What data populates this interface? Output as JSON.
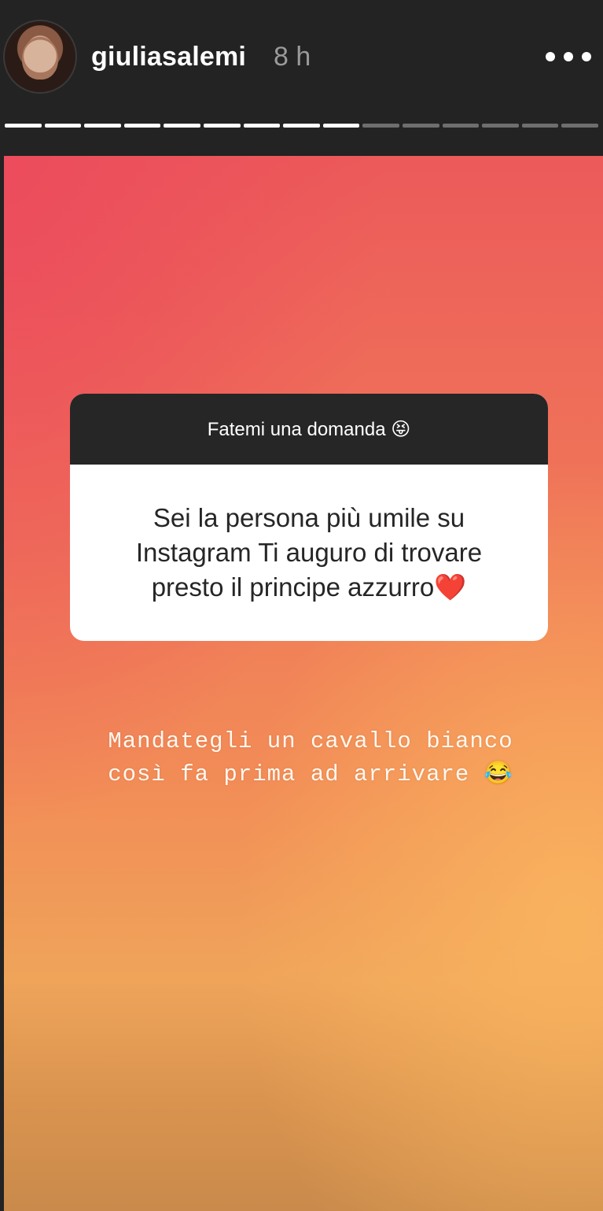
{
  "header": {
    "username": "giuliasalemi",
    "time": "8 h",
    "more_icon": "more-horizontal-icon",
    "progress_total_segments": 15,
    "progress_completed_segments": 9
  },
  "question_sticker": {
    "prompt": "Fatemi una domanda 😝",
    "question": "Sei la persona più umile su Instagram Ti auguro di trovare presto il principe azzurro❤️"
  },
  "reply": {
    "line1": "Mandategli un cavallo bianco",
    "line2": "così fa prima ad arrivare 😂"
  },
  "colors": {
    "header_bg": "#232323",
    "gradient_top": "#ec5a5a",
    "gradient_bottom": "#c98a4b",
    "sticker_header_bg": "#262626"
  }
}
